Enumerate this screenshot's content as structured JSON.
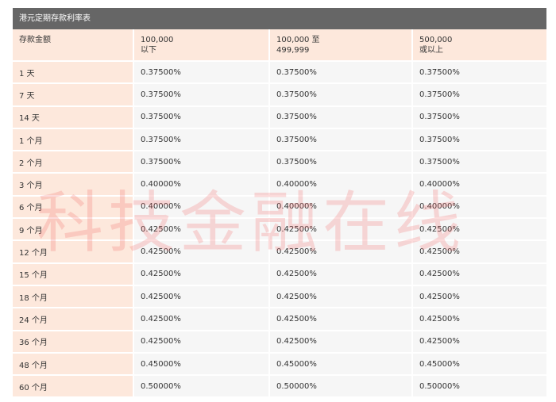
{
  "table_title": "港元定期存款利率表",
  "header": {
    "label": "存款金额",
    "tiers": [
      [
        "100,000",
        "以下"
      ],
      [
        "100,000 至",
        "499,999"
      ],
      [
        "500,000",
        "或以上"
      ]
    ]
  },
  "rows": [
    {
      "term": "1 天",
      "rates": [
        "0.37500%",
        "0.37500%",
        "0.37500%"
      ]
    },
    {
      "term": "7 天",
      "rates": [
        "0.37500%",
        "0.37500%",
        "0.37500%"
      ]
    },
    {
      "term": "14 天",
      "rates": [
        "0.37500%",
        "0.37500%",
        "0.37500%"
      ]
    },
    {
      "term": "1 个月",
      "rates": [
        "0.37500%",
        "0.37500%",
        "0.37500%"
      ]
    },
    {
      "term": "2 个月",
      "rates": [
        "0.37500%",
        "0.37500%",
        "0.37500%"
      ]
    },
    {
      "term": "3 个月",
      "rates": [
        "0.40000%",
        "0.40000%",
        "0.40000%"
      ]
    },
    {
      "term": "6 个月",
      "rates": [
        "0.40000%",
        "0.40000%",
        "0.40000%"
      ]
    },
    {
      "term": "9 个月",
      "rates": [
        "0.42500%",
        "0.42500%",
        "0.42500%"
      ]
    },
    {
      "term": "12 个月",
      "rates": [
        "0.42500%",
        "0.42500%",
        "0.42500%"
      ]
    },
    {
      "term": "15 个月",
      "rates": [
        "0.42500%",
        "0.42500%",
        "0.42500%"
      ]
    },
    {
      "term": "18 个月",
      "rates": [
        "0.42500%",
        "0.42500%",
        "0.42500%"
      ]
    },
    {
      "term": "24 个月",
      "rates": [
        "0.42500%",
        "0.42500%",
        "0.42500%"
      ]
    },
    {
      "term": "36 个月",
      "rates": [
        "0.42500%",
        "0.42500%",
        "0.42500%"
      ]
    },
    {
      "term": "48 个月",
      "rates": [
        "0.45000%",
        "0.45000%",
        "0.45000%"
      ]
    },
    {
      "term": "60 个月",
      "rates": [
        "0.50000%",
        "0.50000%",
        "0.50000%"
      ]
    }
  ],
  "watermark": "科技金融在线"
}
